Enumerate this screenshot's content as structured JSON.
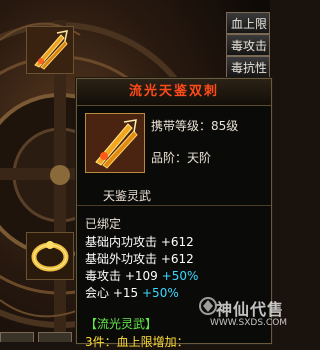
{
  "side_tabs": [
    {
      "label": "血上限"
    },
    {
      "label": "毒攻击"
    },
    {
      "label": "毒抗性"
    }
  ],
  "item": {
    "name": "流光天鉴双刺",
    "carry_level_label": "携带等级：",
    "carry_level_value": "85级",
    "grade_label": "品阶：",
    "grade_value": "天阶",
    "type": "天鉴灵武",
    "bound": "已绑定",
    "stats": [
      {
        "name": "基础内功攻击",
        "value": "+612",
        "bonus": ""
      },
      {
        "name": "基础外功攻击",
        "value": "+612",
        "bonus": ""
      },
      {
        "name": "毒攻击",
        "value": "+109",
        "bonus": "+50%"
      },
      {
        "name": "会心",
        "value": "+15",
        "bonus": "+50%"
      }
    ],
    "set_title": "【流光灵武】",
    "set_line": "3件：血上限增加："
  },
  "watermark": {
    "text": "神仙代售",
    "url": "WWW.SXDS.COM"
  },
  "colors": {
    "title": "#ff4a1a",
    "bonus": "#39d9ff",
    "set_title": "#62e84a",
    "set_line": "#ffdc3a"
  },
  "icons": {
    "slot_top": "twin-dagger-icon",
    "slot_bottom": "golden-ring-icon",
    "tooltip_icon": "twin-dagger-icon"
  }
}
